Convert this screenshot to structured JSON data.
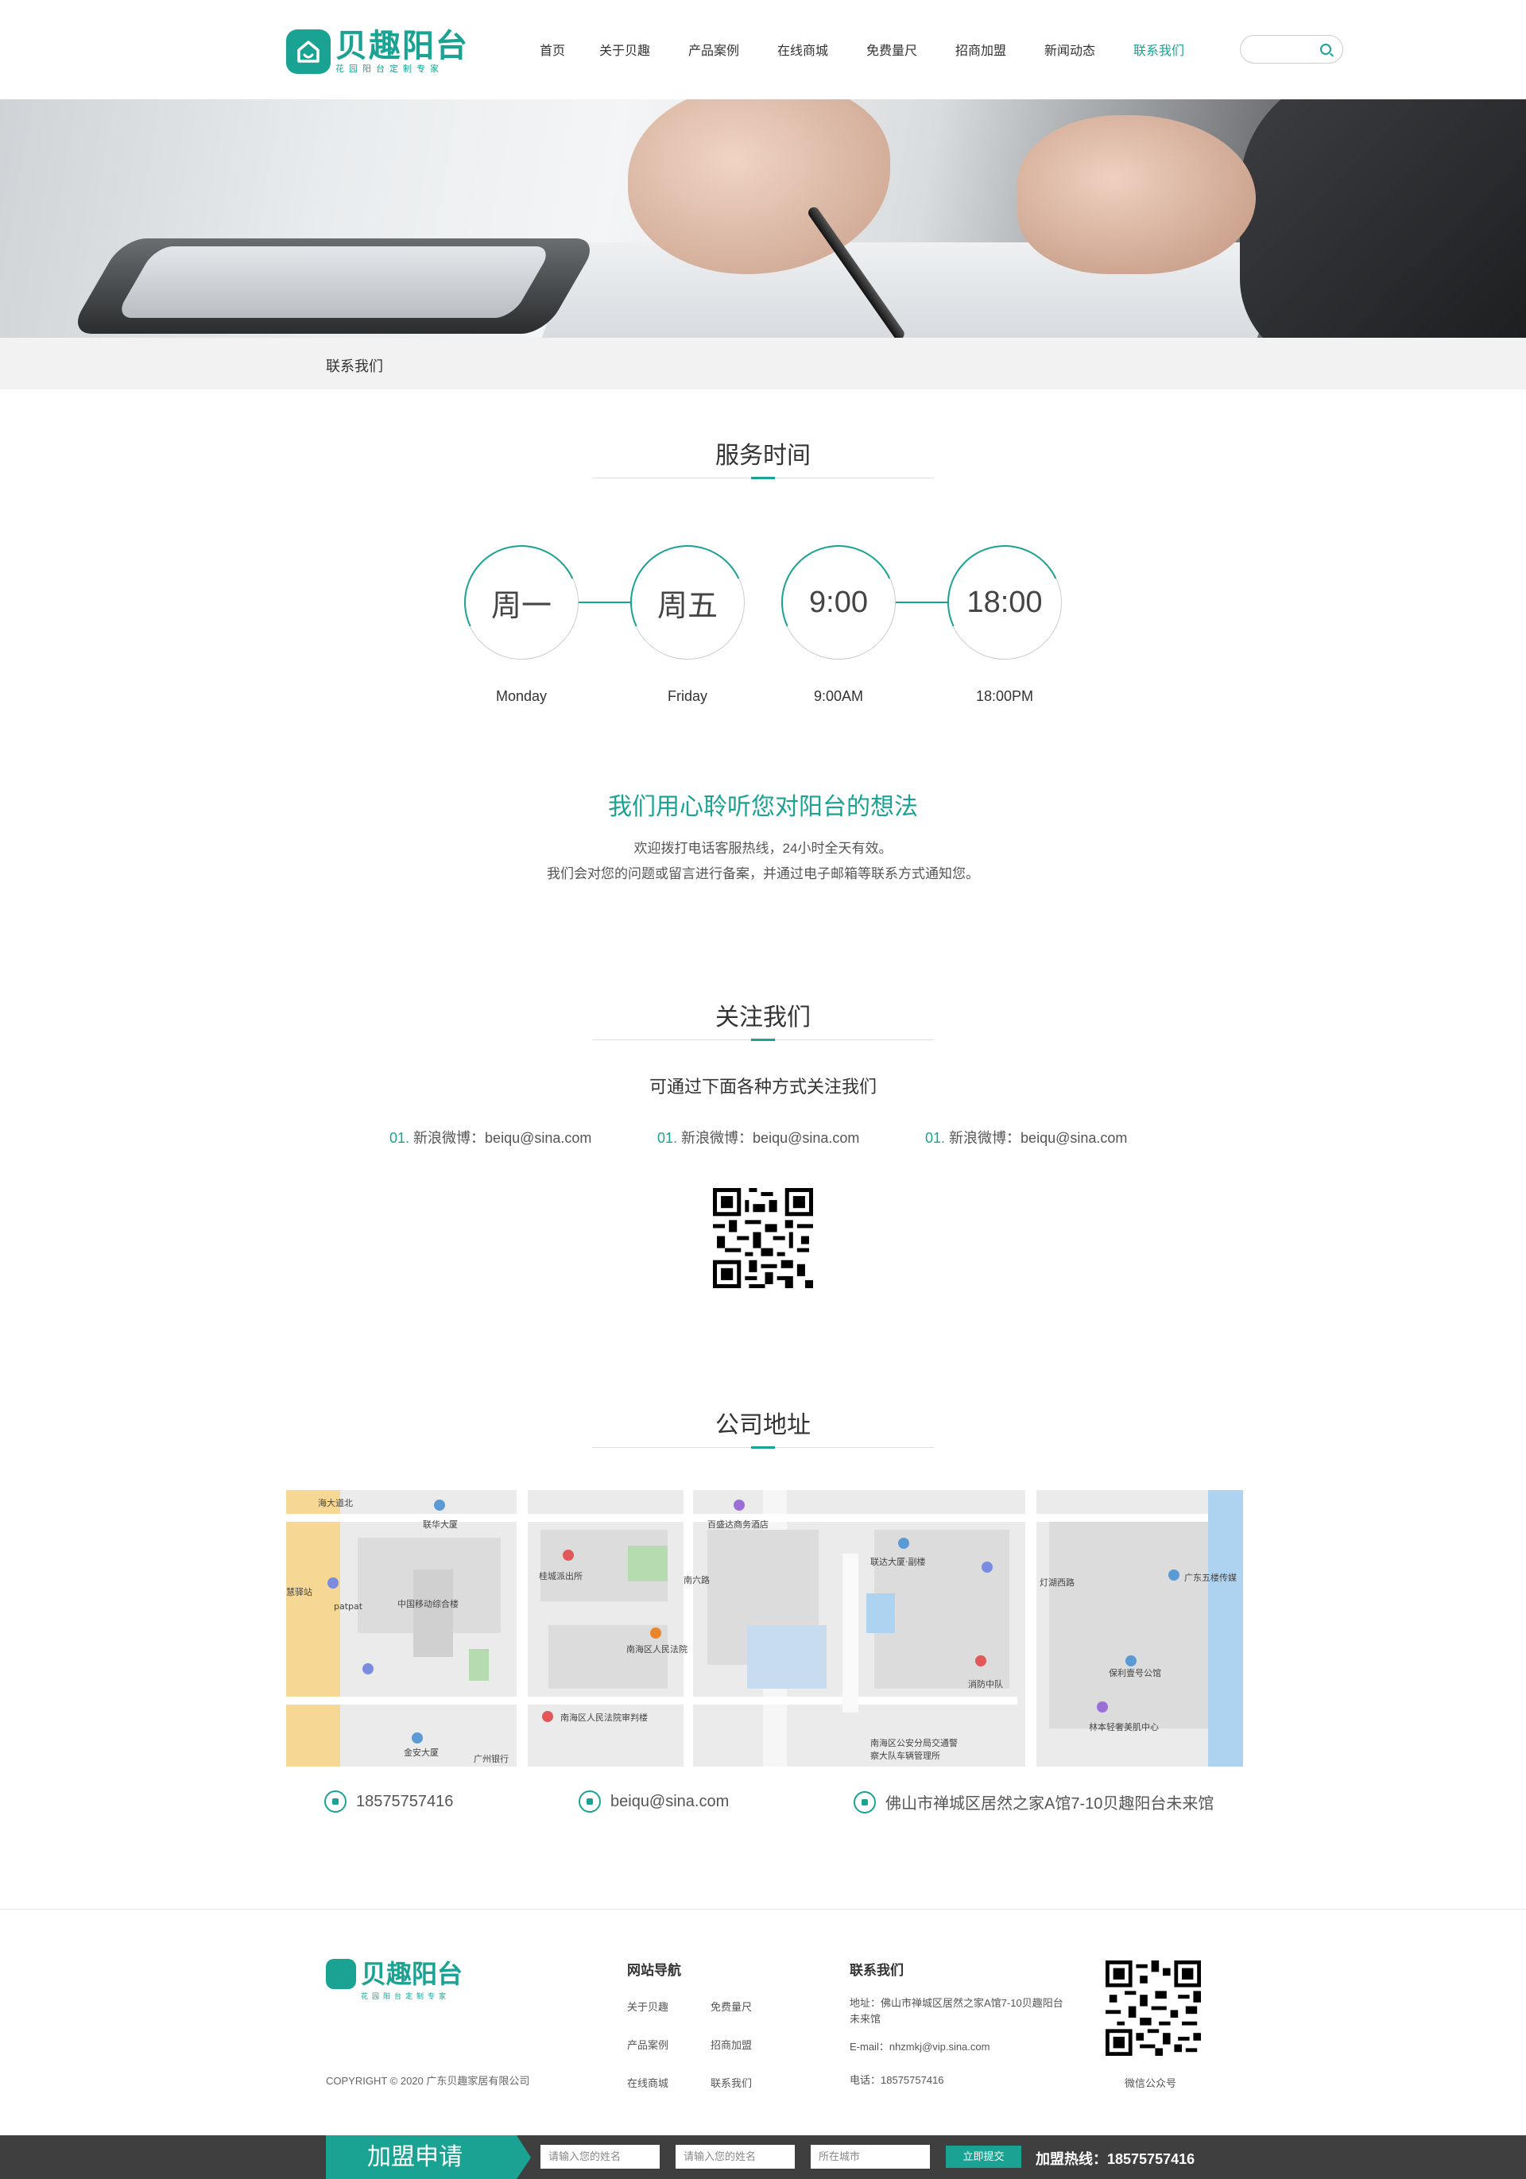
{
  "header": {
    "logo_title": "贝趣阳台",
    "logo_sub": "花园阳台定制专家",
    "nav": [
      "首页",
      "关于贝趣",
      "产品案例",
      "在线商城",
      "免费量尺",
      "招商加盟",
      "新闻动态",
      "联系我们"
    ],
    "active_nav": "联系我们",
    "search_placeholder": ""
  },
  "breadcrumb": "联系我们",
  "service": {
    "title": "服务时间",
    "circles": [
      {
        "value": "周一",
        "label": "Monday"
      },
      {
        "value": "周五",
        "label": "Friday"
      },
      {
        "value": "9:00",
        "label": "9:00AM"
      },
      {
        "value": "18:00",
        "label": "18:00PM"
      }
    ],
    "slogan": "我们用心聆听您对阳台的想法",
    "desc_line1": "欢迎拨打电话客服热线，24小时全天有效。",
    "desc_line2": "我们会对您的问题或留言进行备案，并通过电子邮箱等联系方式通知您。"
  },
  "follow": {
    "title": "关注我们",
    "subtitle": "可通过下面各种方式关注我们",
    "items": [
      {
        "num": "01.",
        "text": "新浪微博：beiqu@sina.com"
      },
      {
        "num": "01.",
        "text": "新浪微博：beiqu@sina.com"
      },
      {
        "num": "01.",
        "text": "新浪微博：beiqu@sina.com"
      }
    ]
  },
  "address": {
    "title": "公司地址",
    "map_labels": [
      "联华大厦",
      "百盛达商务酒店",
      "联达大厦·副楼",
      "广东五楼传媒",
      "桂城派出所",
      "中国移动综合楼",
      "patpat",
      "南海区人民法院",
      "南海区人民法院审判楼",
      "金安大厦",
      "广州银行",
      "消防中队",
      "保利壹号公馆",
      "林本轻奢美肌中心",
      "南海区公安分局交通警察大队车辆管理所",
      "南六路",
      "灯湖西路",
      "海大道北",
      "慧驿站"
    ],
    "phone": "18575757416",
    "email": "beiqu@sina.com",
    "addr": "佛山市禅城区居然之家A馆7-10贝趣阳台未来馆"
  },
  "footer": {
    "logo_title": "贝趣阳台",
    "logo_sub": "花园阳台定制专家",
    "copyright": "COPYRIGHT © 2020 广东贝趣家居有限公司",
    "nav_head": "网站导航",
    "nav_links": [
      "关于贝趣",
      "免费量尺",
      "产品案例",
      "招商加盟",
      "在线商城",
      "联系我们"
    ],
    "contact_head": "联系我们",
    "addr": "地址：佛山市禅城区居然之家A馆7-10贝趣阳台未来馆",
    "email": "E-mail：nhzmkj@vip.sina.com",
    "phone": "电话：18575757416",
    "qr_label": "微信公众号"
  },
  "join": {
    "title": "加盟申请",
    "name_placeholder_1": "请输入您的姓名",
    "name_placeholder_2": "请输入您的姓名",
    "city_placeholder": "所在城市",
    "submit": "立即提交",
    "hotline": "加盟热线：18575757416"
  },
  "colors": {
    "accent": "#1aa393",
    "join_bar": "#3f3f3f"
  }
}
